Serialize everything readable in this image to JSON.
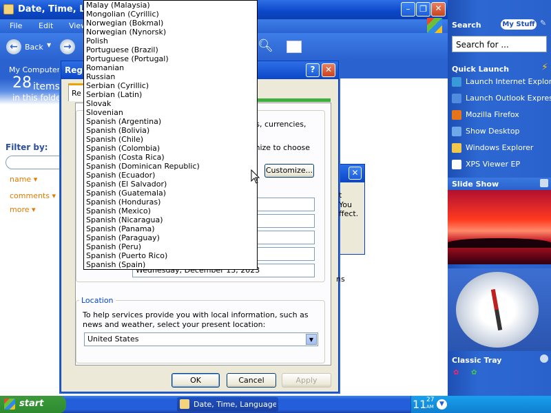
{
  "explorer": {
    "title": "Date, Time, Language,",
    "menu": [
      "File",
      "Edit",
      "View"
    ],
    "back_label": "Back",
    "address_text": "My Computer",
    "items_count": "28",
    "items_label": "items",
    "items_sub": "in this folder",
    "filter_label": "Filter by:",
    "filter_links": [
      "name",
      "comments",
      "more"
    ],
    "behind_text": [
      "ers, currencies,",
      "omize to choose",
      "t",
      "You",
      "ffect.",
      "ns"
    ]
  },
  "dialog": {
    "title": "Regi",
    "tab_label": "Re",
    "customize_label": "Customize...",
    "long_date_value": "Wednesday, December 13, 2023",
    "location_group": "Location",
    "location_text": "To help services provide you with local information, such as news and weather, select your present location:",
    "location_value": "United States",
    "ok_label": "OK",
    "cancel_label": "Cancel",
    "apply_label": "Apply"
  },
  "dropdown": {
    "items": [
      "Malay (Malaysia)",
      "Mongolian (Cyrillic)",
      "Norwegian (Bokmal)",
      "Norwegian (Nynorsk)",
      "Polish",
      "Portuguese (Brazil)",
      "Portuguese (Portugal)",
      "Romanian",
      "Russian",
      "Serbian (Cyrillic)",
      "Serbian (Latin)",
      "Slovak",
      "Slovenian",
      "Spanish (Argentina)",
      "Spanish (Bolivia)",
      "Spanish (Chile)",
      "Spanish (Colombia)",
      "Spanish (Costa Rica)",
      "Spanish (Dominican Republic)",
      "Spanish (Ecuador)",
      "Spanish (El Salvador)",
      "Spanish (Guatemala)",
      "Spanish (Honduras)",
      "Spanish (Mexico)",
      "Spanish (Nicaragua)",
      "Spanish (Panama)",
      "Spanish (Paraguay)",
      "Spanish (Peru)",
      "Spanish (Puerto Rico)",
      "Spanish (Spain)"
    ]
  },
  "sidebar": {
    "search_head": "Search",
    "my_stuff": "My Stuff",
    "search_placeholder": "Search for ...",
    "quick_launch_head": "Quick Launch",
    "quick_launch": [
      {
        "label": "Launch Internet Explorer",
        "icon": "ie-icon",
        "color": "#3a9ad9"
      },
      {
        "label": "Launch Outlook Express",
        "icon": "outlook-icon",
        "color": "#4f8ce0"
      },
      {
        "label": "Mozilla Firefox",
        "icon": "firefox-icon",
        "color": "#e8741a"
      },
      {
        "label": "Show Desktop",
        "icon": "desktop-icon",
        "color": "#6fa8e8"
      },
      {
        "label": "Windows Explorer",
        "icon": "folder-icon",
        "color": "#f1c84b"
      },
      {
        "label": "XPS Viewer EP",
        "icon": "xps-icon",
        "color": "#ffffff"
      }
    ],
    "slideshow_head": "Slide Show",
    "classic_tray_head": "Classic Tray"
  },
  "taskbar": {
    "start_label": "start",
    "task_label": "Date, Time, Language, ...",
    "clock_hour": "11",
    "clock_min": "27",
    "clock_ampm": "AM"
  },
  "colors": {
    "accent": "#2a64d4",
    "start_green": "#3c9a3c"
  }
}
